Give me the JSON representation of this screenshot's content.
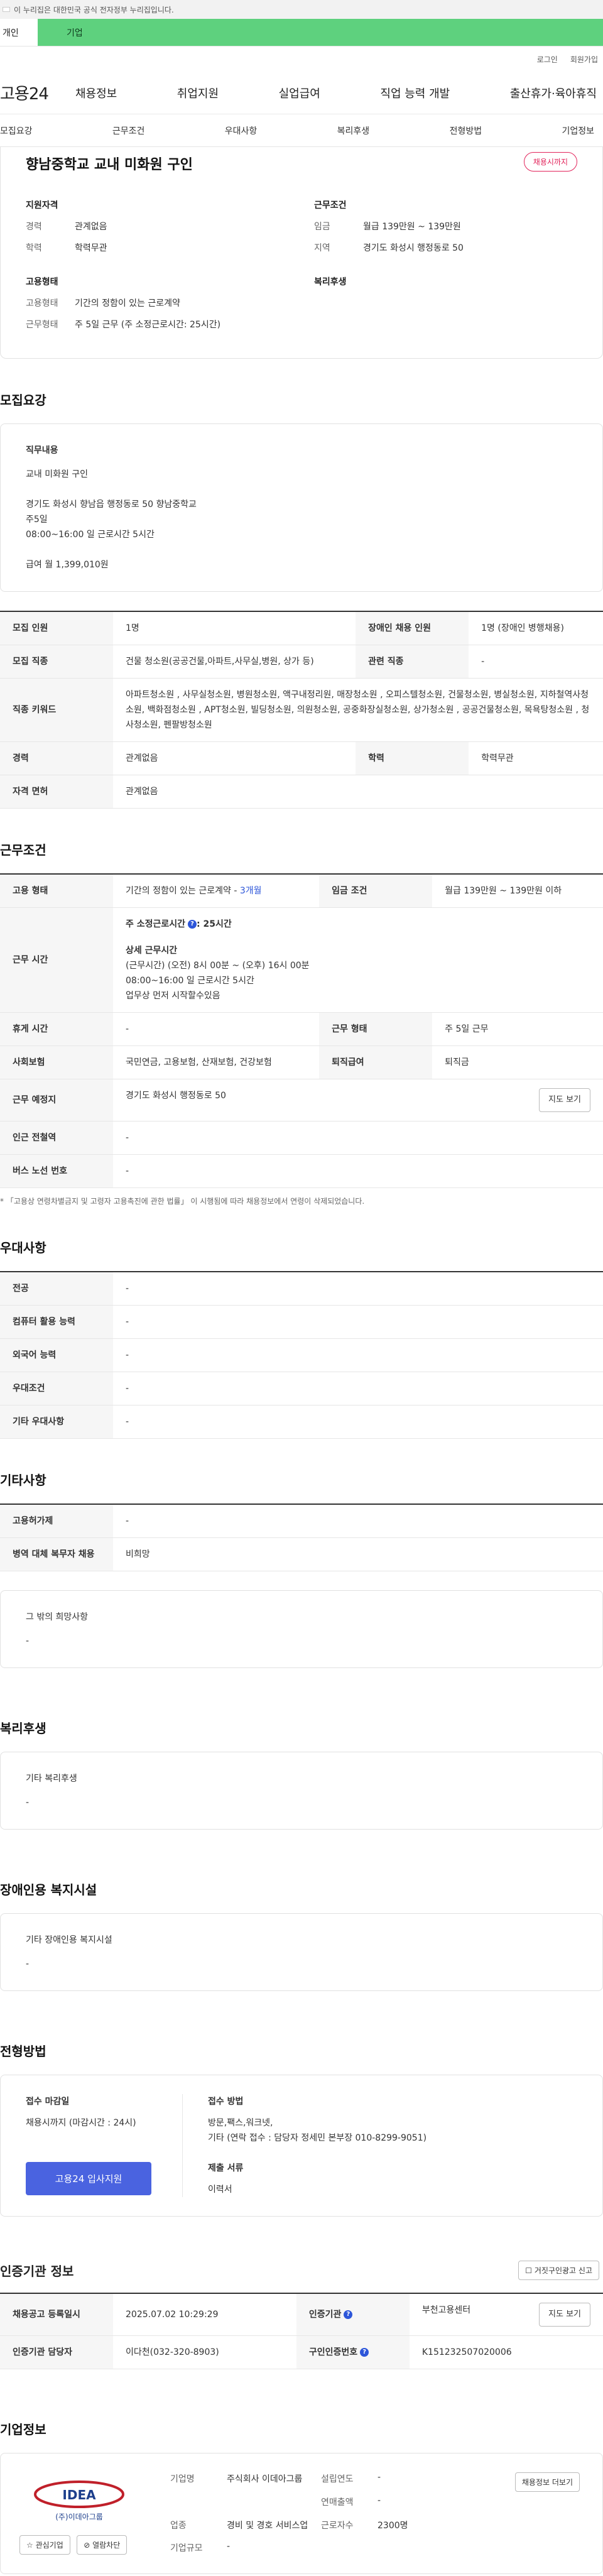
{
  "banner": {
    "notice": "이 누리집은 대한민국 공식 전자정부 누리집입니다."
  },
  "usertabs": {
    "personal": "개인",
    "company": "기업"
  },
  "util": {
    "login": "로그인",
    "join": "회원가입"
  },
  "gnb": {
    "logo": "고용24",
    "items": [
      "채용정보",
      "취업지원",
      "실업급여",
      "직업 능력 개발",
      "출산휴가·육아휴직"
    ]
  },
  "subnav": [
    "모집요강",
    "근무조건",
    "우대사항",
    "복리후생",
    "전형방법",
    "기업정보"
  ],
  "job": {
    "title": "향남중학교 교내 미화원 구인",
    "deadline_badge": "채용시까지",
    "qual_title": "지원자격",
    "career_k": "경력",
    "career_v": "관계없음",
    "edu_k": "학력",
    "edu_v": "학력무관",
    "cond_title": "근무조건",
    "wage_k": "임금",
    "wage_v": "월급 139만원 ~ 139만원",
    "region_k": "지역",
    "region_v": "경기도 화성시 행정동로 50",
    "emp_title": "고용형태",
    "emptype_k": "고용형태",
    "emptype_v": "기간의 정함이 있는 근로계약",
    "worktype_k": "근무형태",
    "worktype_v": "주 5일 근무 (주 소정근로시간: 25시간)",
    "welfare_title": "복리후생"
  },
  "recruit": {
    "section": "모집요강",
    "duty_title": "직무내용",
    "duty_lines": [
      "교내 미화원 구인",
      "",
      "경기도 화성시 향남읍 행정동로 50 향남중학교",
      "주5일",
      "08:00~16:00 일 근로시간 5시간",
      "",
      "급여 월 1,399,010원"
    ],
    "rows": [
      {
        "k1": "모집 인원",
        "v1": "1명",
        "k2": "장애인 채용 인원",
        "v2": "1명 (장애인 병행채용)"
      },
      {
        "k1": "모집 직종",
        "v1": "건물 청소원(공공건물,아파트,사무실,병원, 상가 등)",
        "k2": "관련 직종",
        "v2": "-"
      },
      {
        "k1": "직종 키워드",
        "v1": "아파트청소원 , 사무실청소원, 병원청소원, 액구내정리원, 매장청소원 , 오피스텔청소원, 건물청소원, 병실청소원, 지하철역사청소원, 백화점청소원 , APT청소원, 빌딩청소원, 의원청소원, 공중화장실청소원, 상가청소원 , 공공건물청소원, 목욕탕청소원 , 청사청소원, 펜팔방청소원"
      },
      {
        "k1": "경력",
        "v1": "관계없음",
        "k2": "학력",
        "v2": "학력무관"
      },
      {
        "k1": "자격 면허",
        "v1": "관계없음"
      }
    ]
  },
  "work": {
    "section": "근무조건",
    "emp_k": "고용 형태",
    "emp_v": "기간의 정함이 있는 근로계약 - ",
    "emp_v2": "3개월",
    "wage_k": "임금 조건",
    "wage_v": "월급 139만원 ~ 139만원 이하",
    "time_k": "근무 시간",
    "time_total": "주 소정근로시간",
    "time_total_v": ": 25시간",
    "time_detail_title": "상세 근무시간",
    "time_detail_lines": [
      "(근무시간) (오전) 8시 00분 ~ (오후) 16시 00분",
      "08:00~16:00 일 근로시간 5시간",
      "업무상 먼저 시작할수있음"
    ],
    "rest_k": "휴게 시간",
    "rest_v": "-",
    "form_k": "근무 형태",
    "form_v": "주 5일 근무",
    "ins_k": "사회보험",
    "ins_v": "국민연금, 고용보험, 산재보험, 건강보험",
    "ret_k": "퇴직급여",
    "ret_v": "퇴직금",
    "place_k": "근무 예정지",
    "place_v": "경기도 화성시 행정동로 50",
    "map_btn": "지도 보기",
    "subway_k": "인근 전철역",
    "subway_v": "-",
    "bus_k": "버스 노선 번호",
    "bus_v": "-",
    "note": "* 「고용상 연령차별금지 및 고령자 고용촉진에 관한 법률」 이 시행됨에 따라 채용정보에서 연령이 삭제되었습니다."
  },
  "pref": {
    "section": "우대사항",
    "rows": [
      {
        "k": "전공",
        "v": "-"
      },
      {
        "k": "컴퓨터 활용 능력",
        "v": "-"
      },
      {
        "k": "외국어 능력",
        "v": "-"
      },
      {
        "k": "우대조건",
        "v": "-"
      },
      {
        "k": "기타 우대사항",
        "v": "-"
      }
    ]
  },
  "etc": {
    "section": "기타사항",
    "rows": [
      {
        "k": "고용허가제",
        "v": "-"
      },
      {
        "k": "병역 대체 복무자 채용",
        "v": "비희망"
      }
    ],
    "other_title": "그 밖의 희망사항",
    "other_v": "-"
  },
  "welfare": {
    "section": "복리후생",
    "title": "기타 복리후생",
    "v": "-"
  },
  "disabled": {
    "section": "장애인용 복지시설",
    "title": "기타 장애인용 복지시설",
    "v": "-"
  },
  "apply": {
    "section": "전형방법",
    "deadline_title": "접수 마감일",
    "deadline_v": "채용시까지 (마감시간 : 24시)",
    "method_title": "접수 방법",
    "method_lines": [
      "방문,팩스,워크넷,",
      "기타 (연락 접수 : 담당자 정세민 본부장 010-8299-9051)"
    ],
    "docs_title": "제출 서류",
    "docs_v": "이력서",
    "apply_btn": "고용24 입사지원"
  },
  "cert": {
    "section": "인증기관 정보",
    "report_btn": "거짓구인광고 신고",
    "reg_k": "채용공고 등록일시",
    "reg_v": "2025.07.02 10:29:29",
    "org_k": "인증기관",
    "org_v": "부천고용센터",
    "map_btn": "지도 보기",
    "mgr_k": "인증기관 담당자",
    "mgr_v": "이다천(032-320-8903)",
    "no_k": "구인인증번호",
    "no_v": "K151232507020006"
  },
  "company": {
    "section": "기업정보",
    "logo_text": "IDEA",
    "logo_sub": "(주)이데아그룹",
    "fav_btn": "관심기업",
    "block_btn": "열람차단",
    "name_k": "기업명",
    "name_v": "주식회사 이데아그룹",
    "est_k": "설립연도",
    "est_v": "-",
    "sales_k": "연매출액",
    "sales_v": "-",
    "ind_k": "업종",
    "ind_v": "경비 및 경호 서비스업",
    "emp_k": "근로자수",
    "emp_v": "2300명",
    "size_k": "기업규모",
    "size_v": "-",
    "jobs_btn": "채용정보 더보기"
  }
}
